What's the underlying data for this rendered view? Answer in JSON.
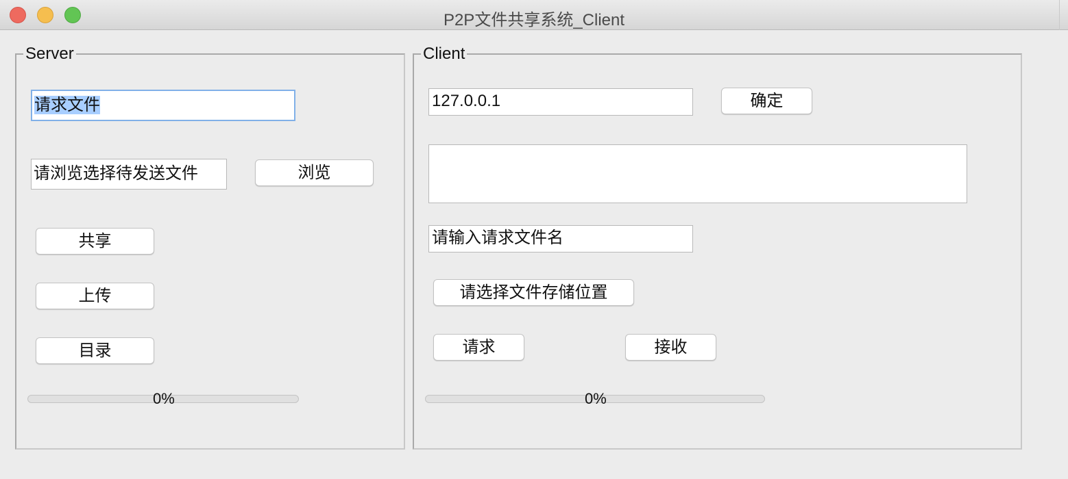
{
  "window": {
    "title": "P2P文件共享系统_Client",
    "controls": {
      "close": "#ee6a5f",
      "minimize": "#f5be4f",
      "maximize": "#62c554"
    }
  },
  "server": {
    "legend": "Server",
    "request_file_value": "请求文件",
    "browse_field_value": "请浏览选择待发送文件",
    "browse_button": "浏览",
    "share_button": "共享",
    "upload_button": "上传",
    "directory_button": "目录",
    "progress": {
      "value": 0,
      "label": "0%"
    }
  },
  "client": {
    "legend": "Client",
    "ip_value": "127.0.0.1",
    "confirm_button": "确定",
    "output_area_value": "",
    "filename_value": "请输入请求文件名",
    "choose_location_button": "请选择文件存储位置",
    "request_button": "请求",
    "receive_button": "接收",
    "progress": {
      "value": 0,
      "label": "0%"
    }
  }
}
